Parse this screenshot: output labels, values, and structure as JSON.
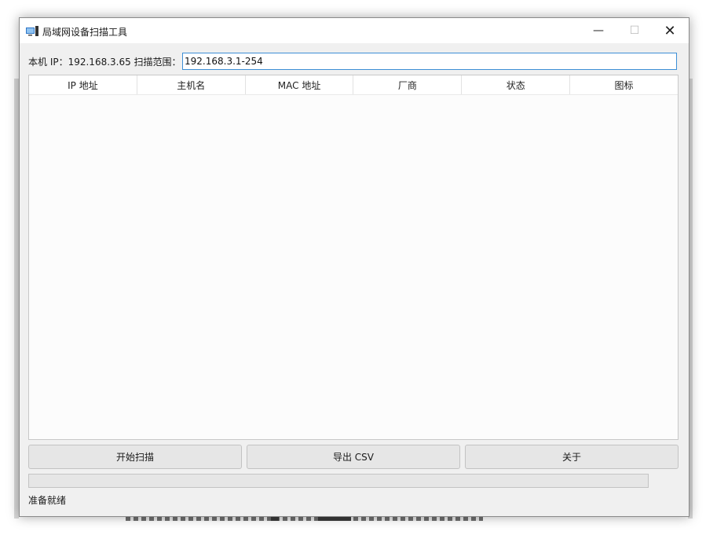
{
  "window": {
    "title": "局域网设备扫描工具",
    "controls": {
      "minimize": "—",
      "maximize": "☐",
      "close": "✕"
    }
  },
  "toolbar": {
    "ip_label": "本机 IP：192.168.3.65  扫描范围：",
    "range_value": "192.168.3.1-254"
  },
  "table": {
    "columns": [
      "IP 地址",
      "主机名",
      "MAC 地址",
      "厂商",
      "状态",
      "图标"
    ],
    "rows": []
  },
  "buttons": {
    "start": "开始扫描",
    "export": "导出 CSV",
    "about": "关于"
  },
  "progress": {
    "value": 0
  },
  "status": {
    "text": "准备就绪"
  },
  "colors": {
    "focus_border": "#3d8fd6",
    "window_bg": "#f0f0f0"
  },
  "icons": {
    "app": "monitor-icon"
  }
}
